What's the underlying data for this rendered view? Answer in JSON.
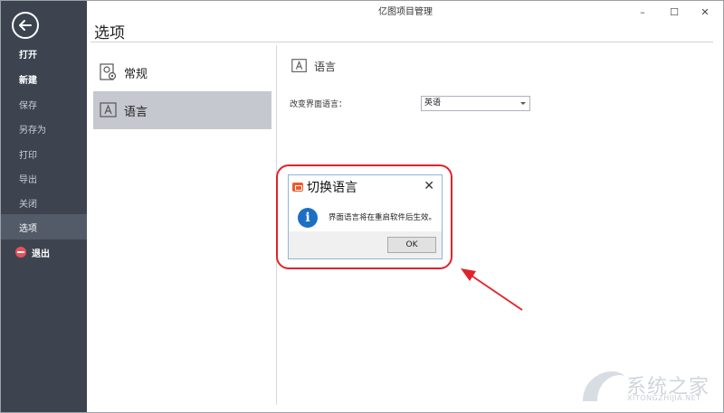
{
  "window": {
    "title": "亿图项目管理",
    "minimize": "–",
    "maximize": "☐",
    "close": "✕"
  },
  "sidebar": {
    "items": [
      {
        "label": "打开"
      },
      {
        "label": "新建"
      },
      {
        "label": "保存"
      },
      {
        "label": "另存为"
      },
      {
        "label": "打印"
      },
      {
        "label": "导出"
      },
      {
        "label": "关闭"
      },
      {
        "label": "选项"
      },
      {
        "label": "退出"
      }
    ]
  },
  "page": {
    "title": "选项"
  },
  "categories": [
    {
      "label": "常规",
      "icon": "settings-icon"
    },
    {
      "label": "语言",
      "icon": "language-icon"
    }
  ],
  "language_section": {
    "heading": "语言",
    "label": "改变界面语言：",
    "selected": "英语"
  },
  "dialog": {
    "title": "切换语言",
    "info_glyph": "i",
    "message": "界面语言将在重启软件后生效。",
    "ok": "OK"
  },
  "watermark": {
    "text": "系统之家",
    "sub": "XITONGZHIJIA.NET"
  },
  "colors": {
    "sidebar_bg": "#3d4450",
    "active_item_bg": "#535b68",
    "category_active_bg": "#c5c8cf",
    "annotation_red": "#e0232a",
    "info_blue": "#1d6fc4"
  }
}
